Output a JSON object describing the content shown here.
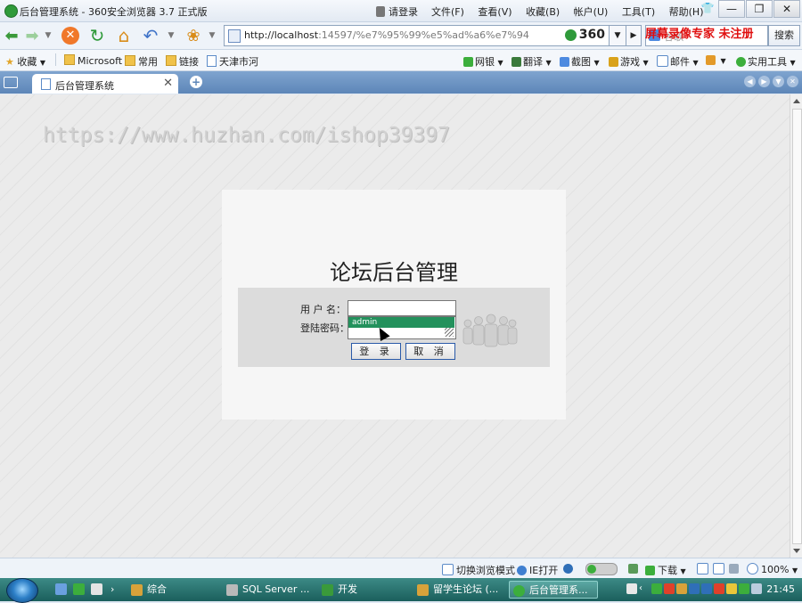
{
  "window": {
    "title": "后台管理系统 - 360安全浏览器 3.7 正式版",
    "login_label": "请登录",
    "menus": [
      "文件(F)",
      "查看(V)",
      "收藏(B)",
      "帐户(U)",
      "工具(T)",
      "帮助(H)"
    ]
  },
  "navbar": {
    "url_host": "http://localhost",
    "url_rest": ":14597/%e7%95%99%e5%ad%a6%e7%94",
    "security_badge": "360",
    "search_placeholder": "谷歌",
    "search_button": "搜索",
    "overlay_watermark": "屏幕录像专家 未注册"
  },
  "favorites": {
    "favorites_label": "收藏",
    "items": [
      "Microsoft",
      "常用",
      "链接",
      "天津市河"
    ],
    "tools": [
      "网银",
      "翻译",
      "截图",
      "游戏",
      "邮件",
      "实用工具"
    ]
  },
  "tab": {
    "label": "后台管理系统"
  },
  "page": {
    "url_watermark": "https://www.huzhan.com/ishop39397",
    "title": "论坛后台管理",
    "username_label": "用 户 名：",
    "password_label": "登陆密码：",
    "autocomplete_value": "admin",
    "login_button": "登 录",
    "cancel_button": "取 消"
  },
  "statusbar": {
    "mode_switch": "切换浏览模式",
    "ie_open": "IE打开",
    "download": "下载",
    "zoom": "100%"
  },
  "taskbar": {
    "tasks": [
      "综合",
      "SQL Server ...",
      "开发",
      "留学生论坛 (...",
      "后台管理系..."
    ],
    "clock": "21:45"
  },
  "colors": {
    "autocomplete_highlight": "#23915c",
    "button_border": "#2a5aa8",
    "registration_watermark": "#e01010"
  }
}
